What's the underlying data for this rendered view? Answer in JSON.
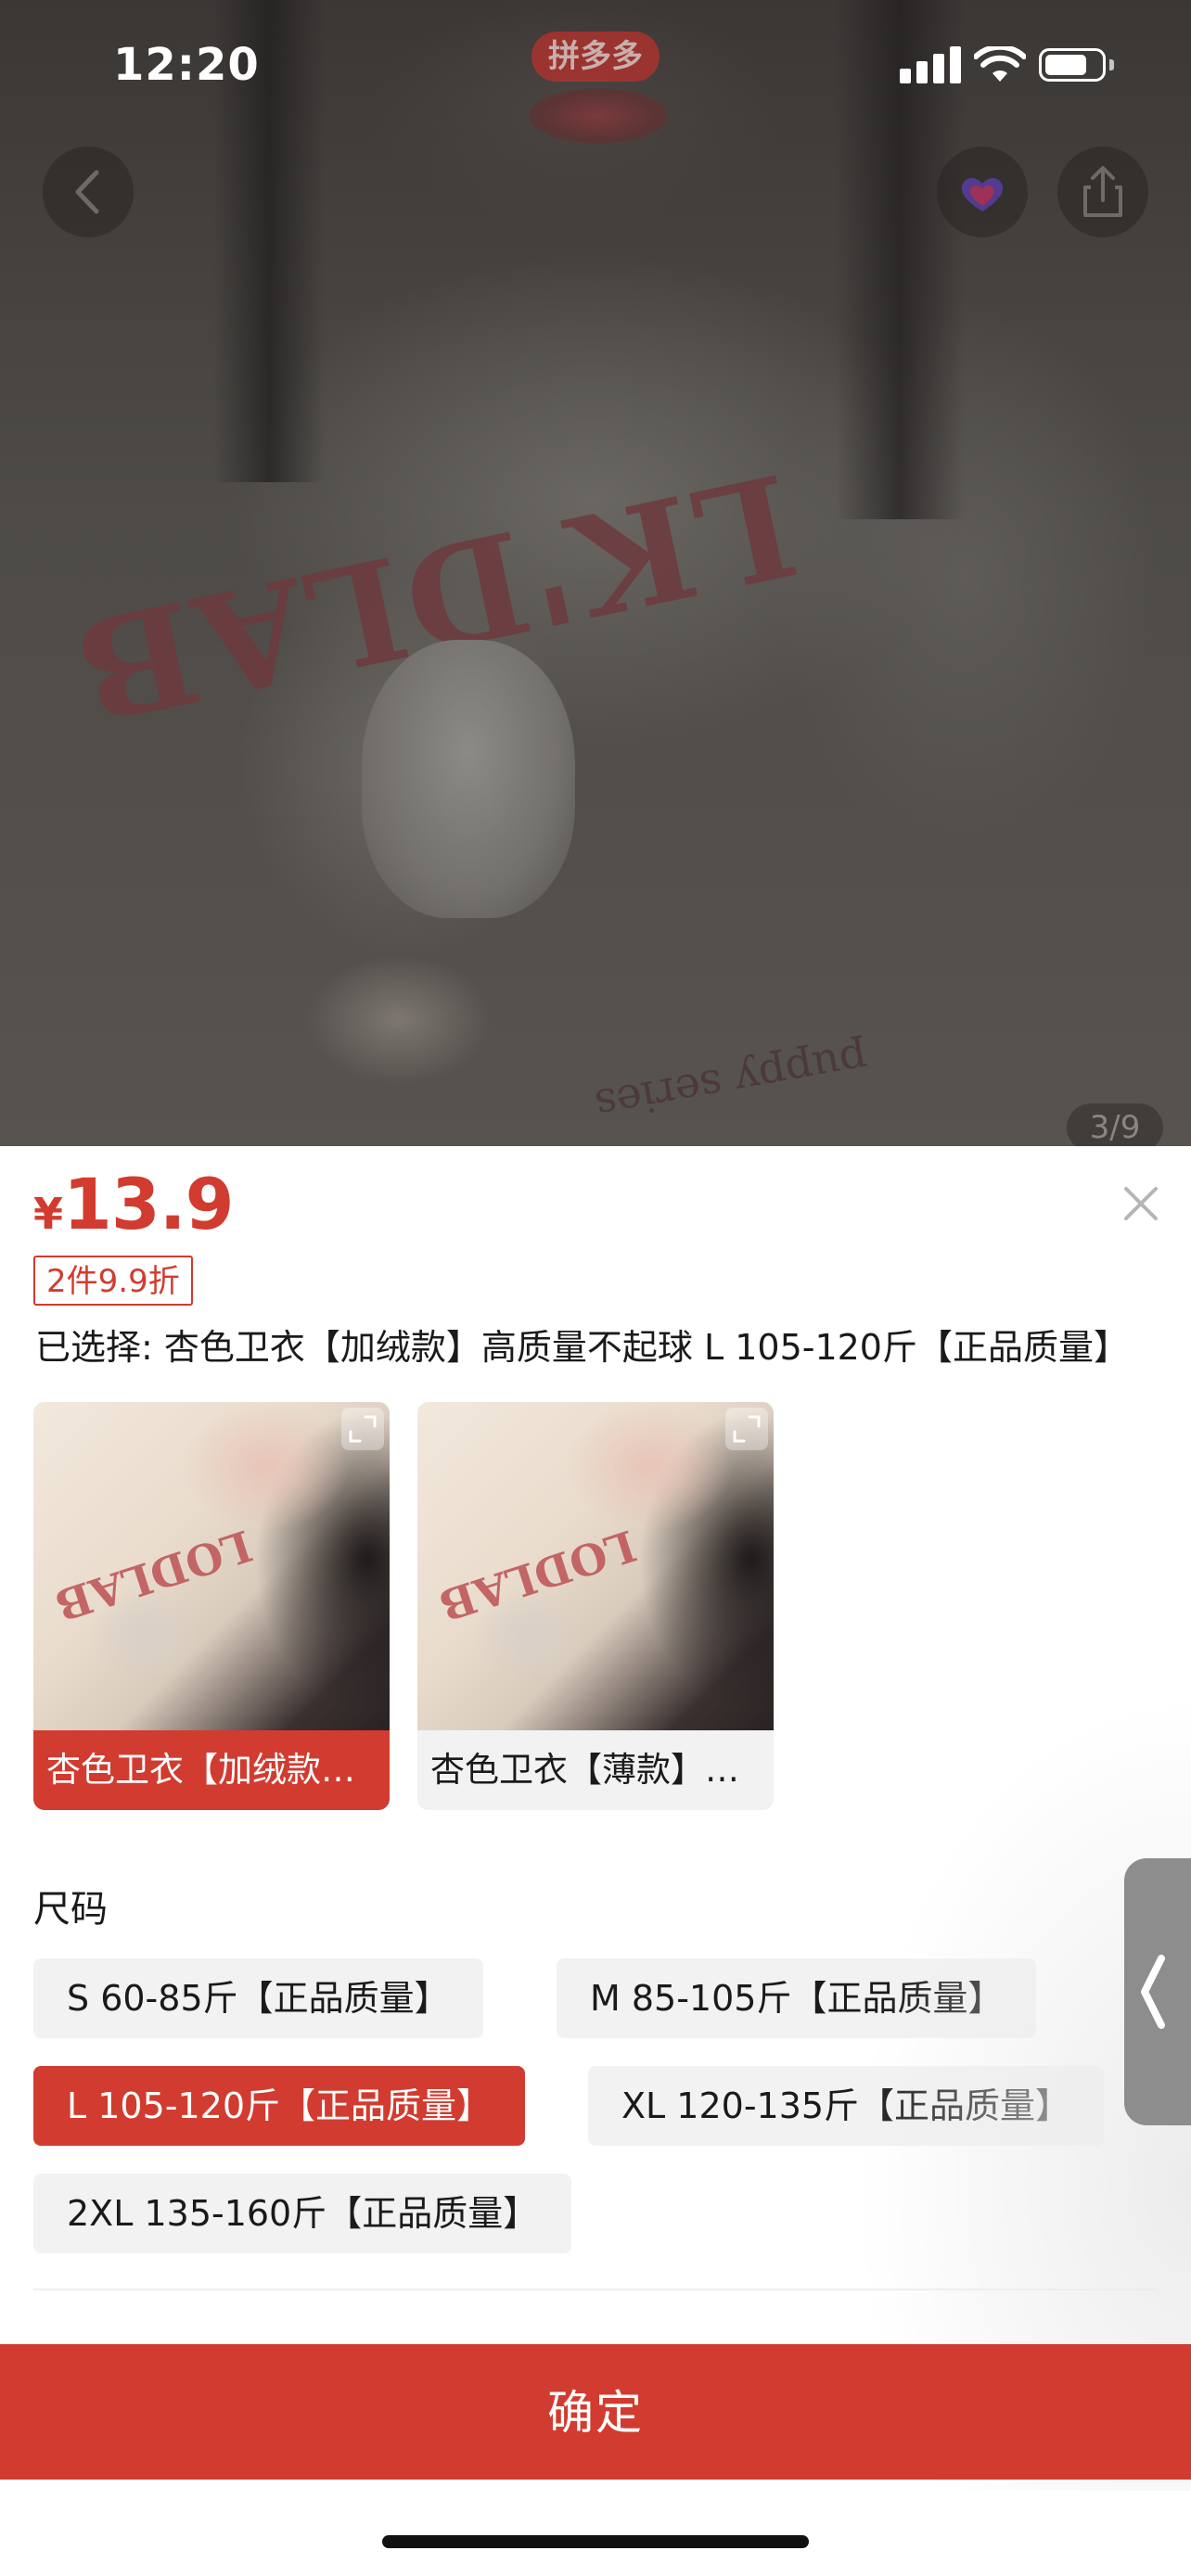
{
  "status_bar": {
    "time": "12:20"
  },
  "header": {
    "app_logo_text": "拼多多"
  },
  "gallery": {
    "counter": "3/9"
  },
  "sheet": {
    "currency": "¥",
    "price": "13.9",
    "promo": "2件9.9折",
    "selected_text": "已选择: 杏色卫衣【加绒款】高质量不起球 L 105-120斤【正品质量】",
    "colors": [
      {
        "label": "杏色卫衣【加绒款】高质量不起球",
        "selected": true
      },
      {
        "label": "杏色卫衣【薄款】高质量不起球",
        "selected": false
      }
    ],
    "size_title": "尺码",
    "sizes": [
      {
        "label": "S 60-85斤【正品质量】",
        "selected": false
      },
      {
        "label": "M 85-105斤【正品质量】",
        "selected": false
      },
      {
        "label": "L 105-120斤【正品质量】",
        "selected": true
      },
      {
        "label": "XL 120-135斤【正品质量】",
        "selected": false
      },
      {
        "label": "2XL 135-160斤【正品质量】",
        "selected": false
      }
    ],
    "confirm_label": "确定"
  },
  "colors": {
    "accent": "#d23b2f",
    "option_bg": "#f2f2f2"
  },
  "icons": [
    "back-arrow-icon",
    "favorite-icon",
    "share-icon",
    "close-icon",
    "expand-icon",
    "chevron-left-icon"
  ]
}
